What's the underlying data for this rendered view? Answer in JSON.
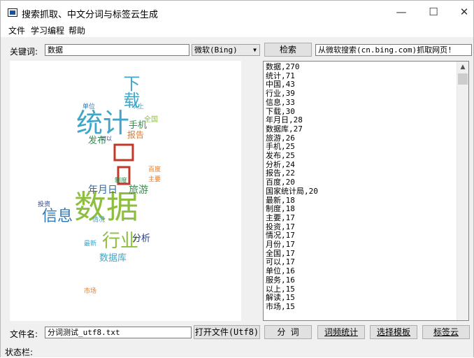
{
  "window": {
    "title": "搜索抓取、中文分词与标签云生成",
    "minimize": "—",
    "maximize": "☐",
    "close": "✕"
  },
  "menu": [
    "文件",
    "学习编程",
    "帮助"
  ],
  "search": {
    "keyword_label": "关键词:",
    "keyword_value": "数据",
    "engine_value": "微软(Bing)",
    "search_button": "检索",
    "status_value": "从微软搜索(cn.bing.com)抓取网页!"
  },
  "word_list": [
    "数据,270",
    "统计,71",
    "中国,43",
    "行业,39",
    "信息,33",
    "下载,30",
    "年月日,28",
    "数据库,27",
    "旅游,26",
    "手机,25",
    "发布,25",
    "分析,24",
    "报告,22",
    "百度,20",
    "国家统计局,20",
    "最新,18",
    "制度,18",
    "主要,17",
    "投资,17",
    "情况,17",
    "月份,17",
    "全国,17",
    "可以,17",
    "单位,16",
    "服务,16",
    "以上,15",
    "解读,15",
    "市场,15"
  ],
  "file": {
    "label": "文件名:",
    "value": "分词测试_utf8.txt",
    "open_button": "打开文件(Utf8)",
    "segment_button": "分 词",
    "freq_button": "词频统计",
    "template_button": "选择模板",
    "cloud_button": "标签云"
  },
  "status_bar": "状态栏:",
  "cloud_words": [
    {
      "text": "数据",
      "color": "#8dbf3e"
    },
    {
      "text": "统计",
      "color": "#3fa6c9"
    },
    {
      "text": "行业",
      "color": "#8dbf3e"
    },
    {
      "text": "信息",
      "color": "#3079b8"
    },
    {
      "text": "下载",
      "color": "#3fa6c9"
    },
    {
      "text": "旅游",
      "color": "#3d8a52"
    },
    {
      "text": "年月日",
      "color": "#34689c"
    },
    {
      "text": "数据库",
      "color": "#3fa6c9"
    },
    {
      "text": "手机",
      "color": "#3d8a52"
    },
    {
      "text": "发布",
      "color": "#3d8a52"
    },
    {
      "text": "分析",
      "color": "#283f80"
    },
    {
      "text": "报告",
      "color": "#e07b2a"
    },
    {
      "text": "全国",
      "color": "#8dbf3e"
    },
    {
      "text": "单位",
      "color": "#3079b8"
    },
    {
      "text": "投资",
      "color": "#283f80"
    },
    {
      "text": "可以",
      "color": "#283f80"
    },
    {
      "text": "市场",
      "color": "#e07b2a"
    },
    {
      "text": "最新",
      "color": "#3fa6c9"
    },
    {
      "text": "百度",
      "color": "#e07b2a"
    },
    {
      "text": "制度",
      "color": "#3d8a52"
    },
    {
      "text": "主要",
      "color": "#e07b2a"
    },
    {
      "text": "情况",
      "color": "#3fa6c9"
    },
    {
      "text": "以上",
      "color": "#3fa6c9"
    }
  ]
}
